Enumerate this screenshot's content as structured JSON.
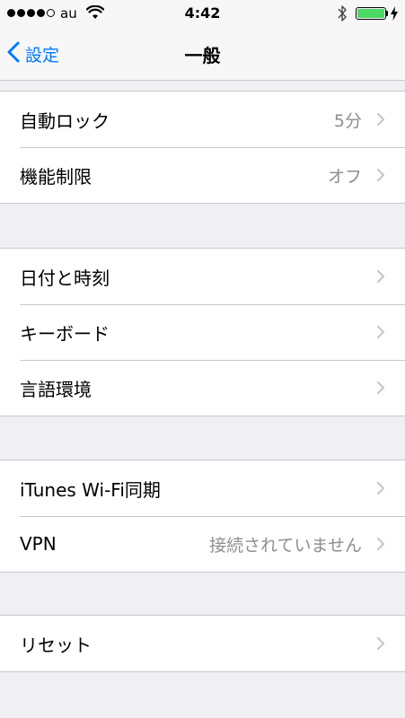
{
  "status_bar": {
    "signal_filled": 4,
    "signal_total": 5,
    "carrier": "au",
    "time": "4:42",
    "battery_level": 1.0,
    "battery_color": "#4cd964"
  },
  "nav": {
    "back_label": "設定",
    "title": "一般",
    "accent_color": "#007aff"
  },
  "groups": [
    {
      "rows": [
        {
          "label": "自動ロック",
          "value": "5分"
        },
        {
          "label": "機能制限",
          "value": "オフ"
        }
      ]
    },
    {
      "rows": [
        {
          "label": "日付と時刻",
          "value": ""
        },
        {
          "label": "キーボード",
          "value": ""
        },
        {
          "label": "言語環境",
          "value": ""
        }
      ]
    },
    {
      "rows": [
        {
          "label": "iTunes Wi-Fi同期",
          "value": ""
        },
        {
          "label": "VPN",
          "value": "接続されていません"
        }
      ]
    },
    {
      "rows": [
        {
          "label": "リセット",
          "value": ""
        }
      ]
    }
  ],
  "icons": {
    "wifi": "wifi-icon",
    "bluetooth": "bluetooth-icon",
    "charging": "charging-bolt-icon",
    "back": "chevron-left-icon",
    "disclosure": "chevron-right-icon"
  }
}
